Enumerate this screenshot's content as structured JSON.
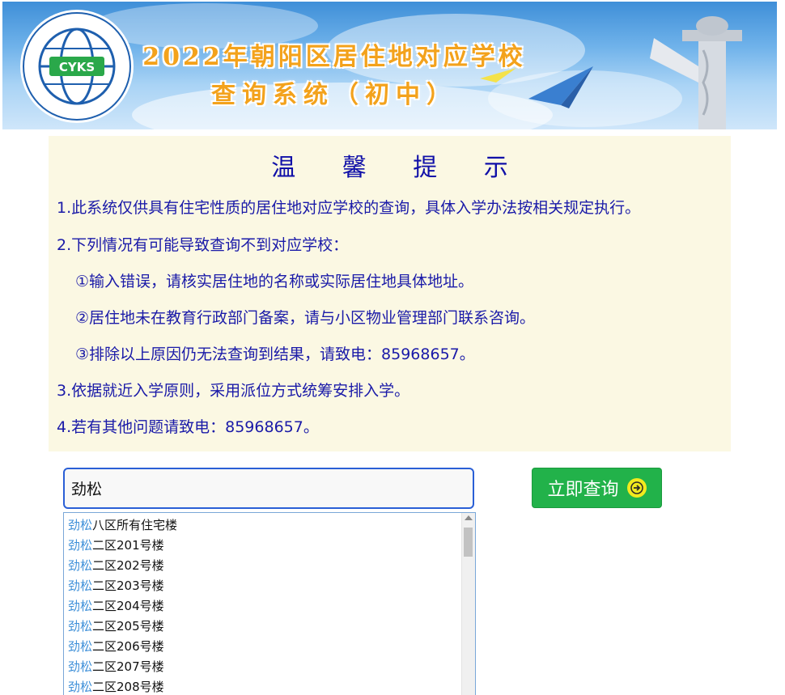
{
  "banner": {
    "title_line1": "2022年朝阳区居住地对应学校",
    "title_line2": "查询系统（初中）",
    "logo_text": "CYKS"
  },
  "notice": {
    "title": "温 馨 提 示",
    "items": [
      "1.此系统仅供具有住宅性质的居住地对应学校的查询，具体入学办法按相关规定执行。",
      "2.下列情况有可能导致查询不到对应学校：",
      "①输入错误，请核实居住地的名称或实际居住地具体地址。",
      "②居住地未在教育行政部门备案，请与小区物业管理部门联系咨询。",
      "③排除以上原因仍无法查询到结果，请致电：85968657。",
      "3.依据就近入学原则，采用派位方式统筹安排入学。",
      "4.若有其他问题请致电：85968657。"
    ]
  },
  "search": {
    "value": "劲松",
    "button_label": "立即查询"
  },
  "suggestions": [
    {
      "match": "劲松",
      "rest": "八区所有住宅楼"
    },
    {
      "match": "劲松",
      "rest": "二区201号楼"
    },
    {
      "match": "劲松",
      "rest": "二区202号楼"
    },
    {
      "match": "劲松",
      "rest": "二区203号楼"
    },
    {
      "match": "劲松",
      "rest": "二区204号楼"
    },
    {
      "match": "劲松",
      "rest": "二区205号楼"
    },
    {
      "match": "劲松",
      "rest": "二区206号楼"
    },
    {
      "match": "劲松",
      "rest": "二区207号楼"
    },
    {
      "match": "劲松",
      "rest": "二区208号楼"
    }
  ],
  "colors": {
    "accent": "#22b24a",
    "notice_bg": "#fbf8e3",
    "notice_text": "#1a1aa8",
    "highlight": "#3d8fd8"
  }
}
